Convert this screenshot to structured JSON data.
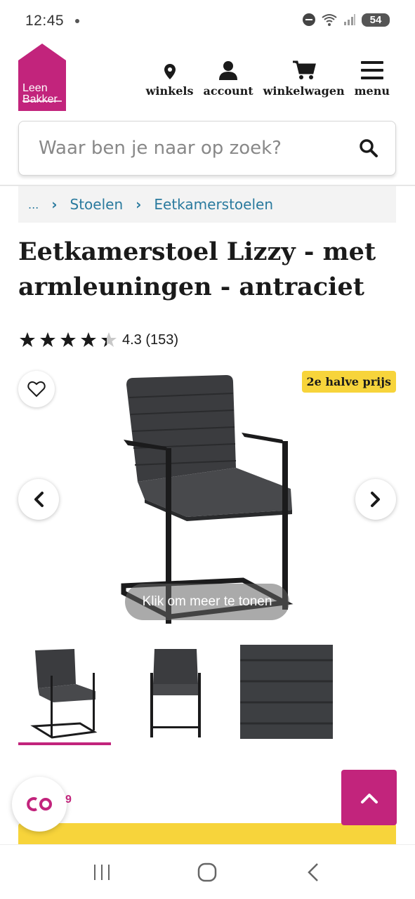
{
  "status_bar": {
    "time": "12:45",
    "battery": "54"
  },
  "brand": {
    "logo_line1": "Leen",
    "logo_line2": "Bakker",
    "color": "#c2247c"
  },
  "nav": {
    "stores": "winkels",
    "account": "account",
    "cart": "winkelwagen",
    "menu": "menu"
  },
  "search": {
    "placeholder": "Waar ben je naar op zoek?"
  },
  "breadcrumb": {
    "ellipsis": "...",
    "level1": "Stoelen",
    "level2": "Eetkamerstoelen"
  },
  "product": {
    "title": "Eetkamerstoel Lizzy - met armleuningen - antraciet",
    "rating_text": "4.3 (153)",
    "rating_value": 4.3,
    "rating_max": 5,
    "promo_badge": "2e halve prijs",
    "click_more": "Klik om meer te tonen"
  },
  "floating": {
    "partial_label": "9"
  },
  "colors": {
    "accent": "#c2247c",
    "promo": "#f7d43b",
    "link": "#2a7a9e"
  }
}
